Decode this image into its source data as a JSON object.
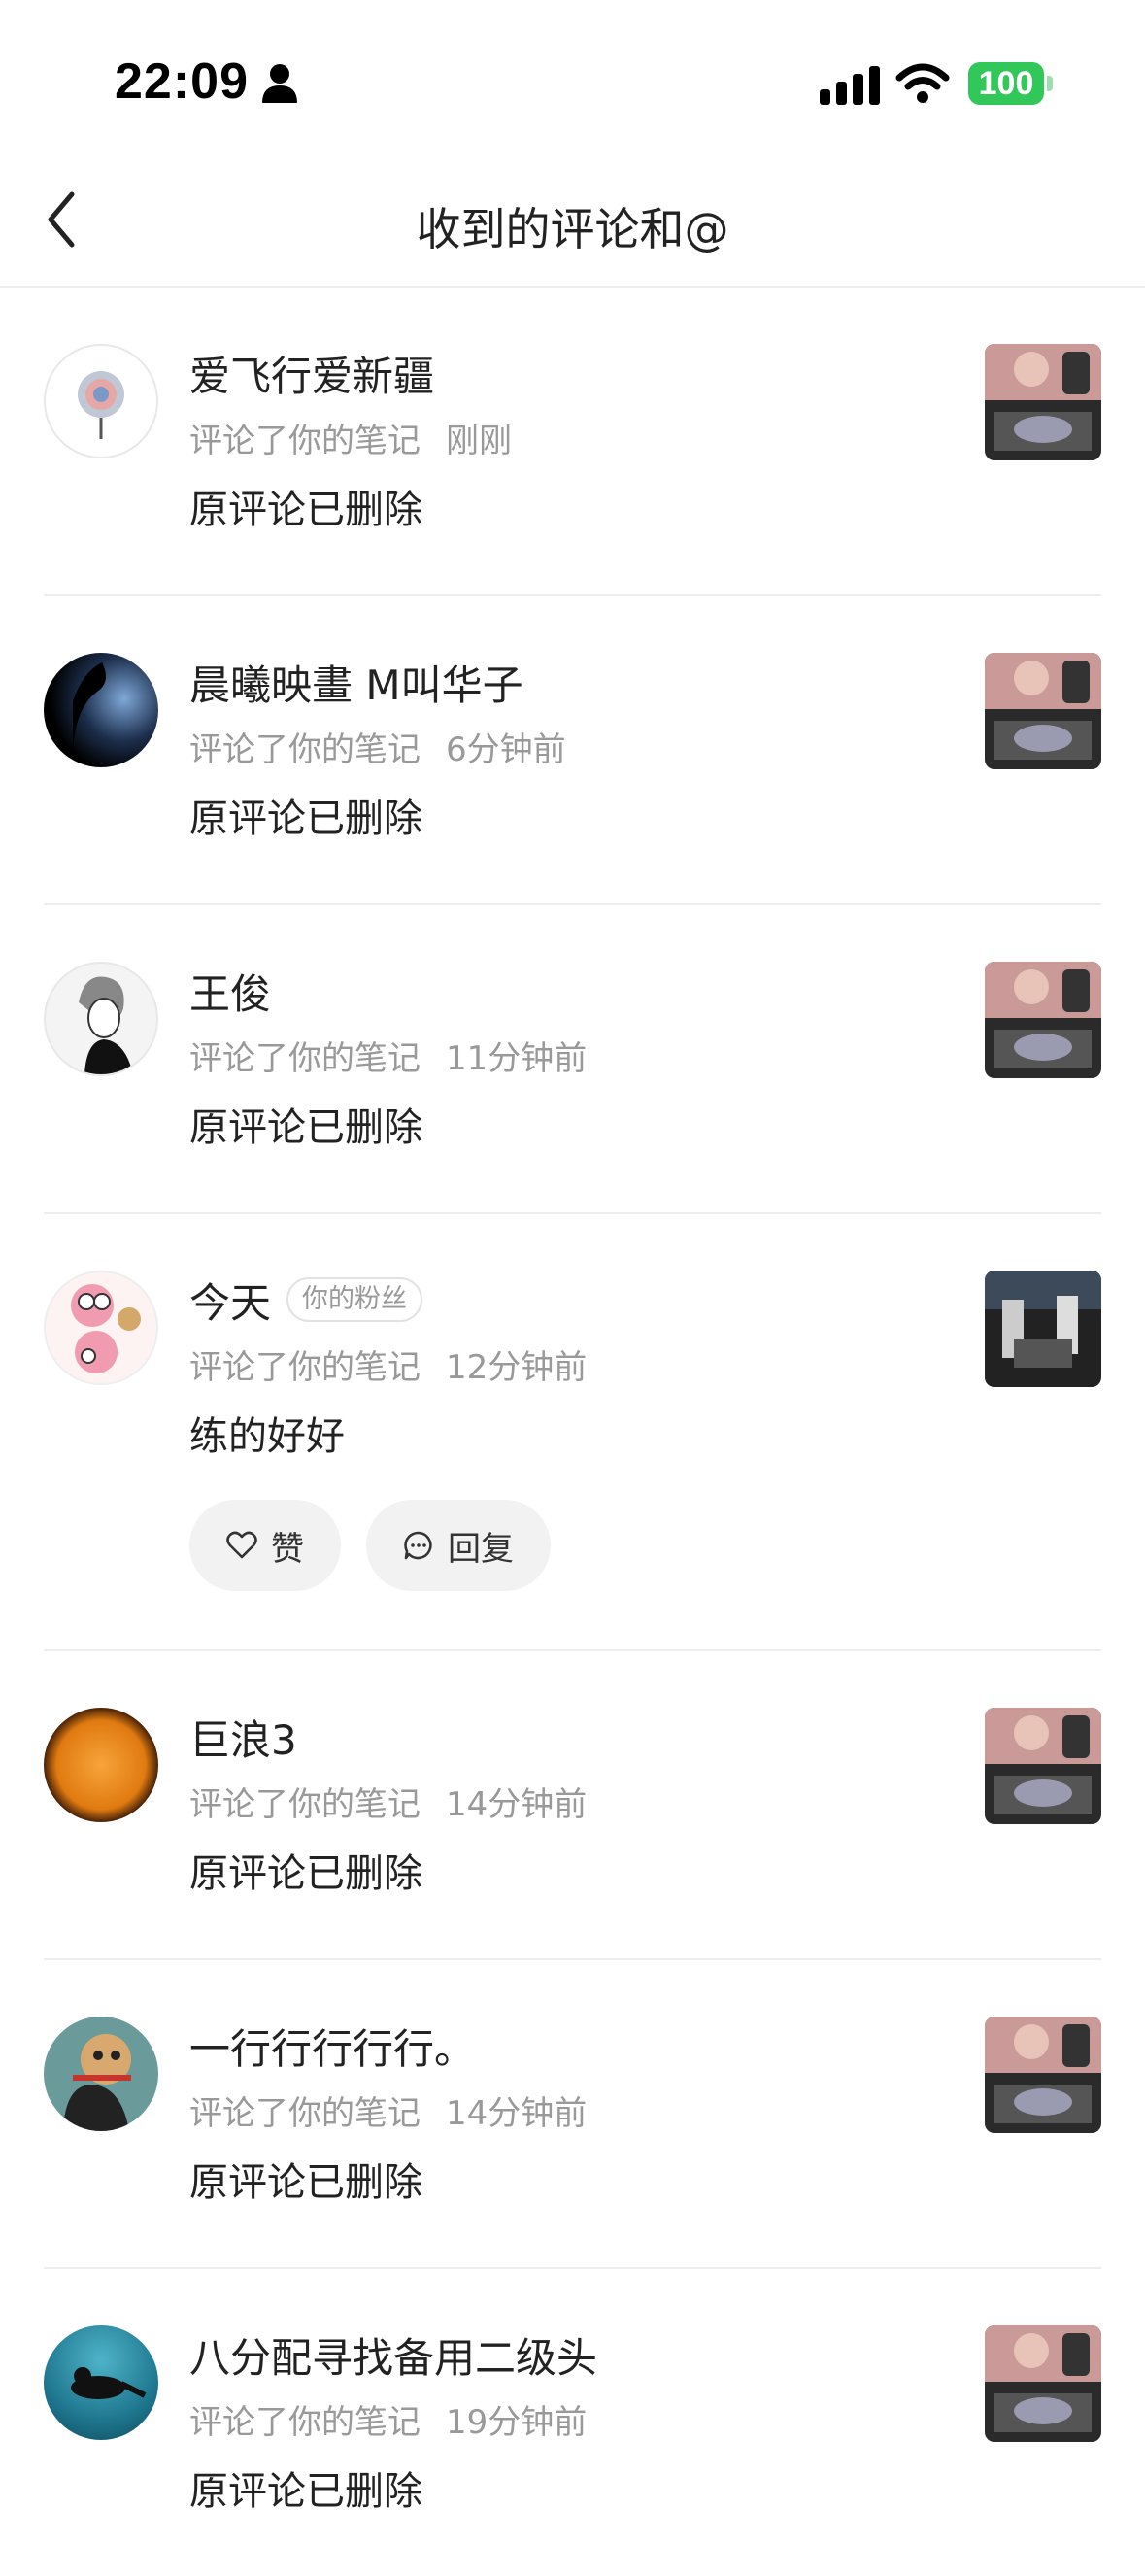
{
  "status_bar": {
    "time": "22:09",
    "battery": "100"
  },
  "header": {
    "title": "收到的评论和@"
  },
  "items": [
    {
      "name": "爱飞行爱新疆",
      "action": "评论了你的笔记",
      "time": "刚刚",
      "content": "原评论已删除"
    },
    {
      "name": "晨曦映畫 M叫华子",
      "action": "评论了你的笔记",
      "time": "6分钟前",
      "content": "原评论已删除"
    },
    {
      "name": "王俊",
      "action": "评论了你的笔记",
      "time": "11分钟前",
      "content": "原评论已删除"
    },
    {
      "name": "今天",
      "badge": "你的粉丝",
      "action": "评论了你的笔记",
      "time": "12分钟前",
      "content": "练的好好",
      "like_label": "赞",
      "reply_label": "回复"
    },
    {
      "name": "巨浪3",
      "action": "评论了你的笔记",
      "time": "14分钟前",
      "content": "原评论已删除"
    },
    {
      "name": "一行行行行行。",
      "action": "评论了你的笔记",
      "time": "14分钟前",
      "content": "原评论已删除"
    },
    {
      "name": "八分配寻找备用二级头",
      "action": "评论了你的笔记",
      "time": "19分钟前",
      "content": "原评论已删除"
    }
  ]
}
